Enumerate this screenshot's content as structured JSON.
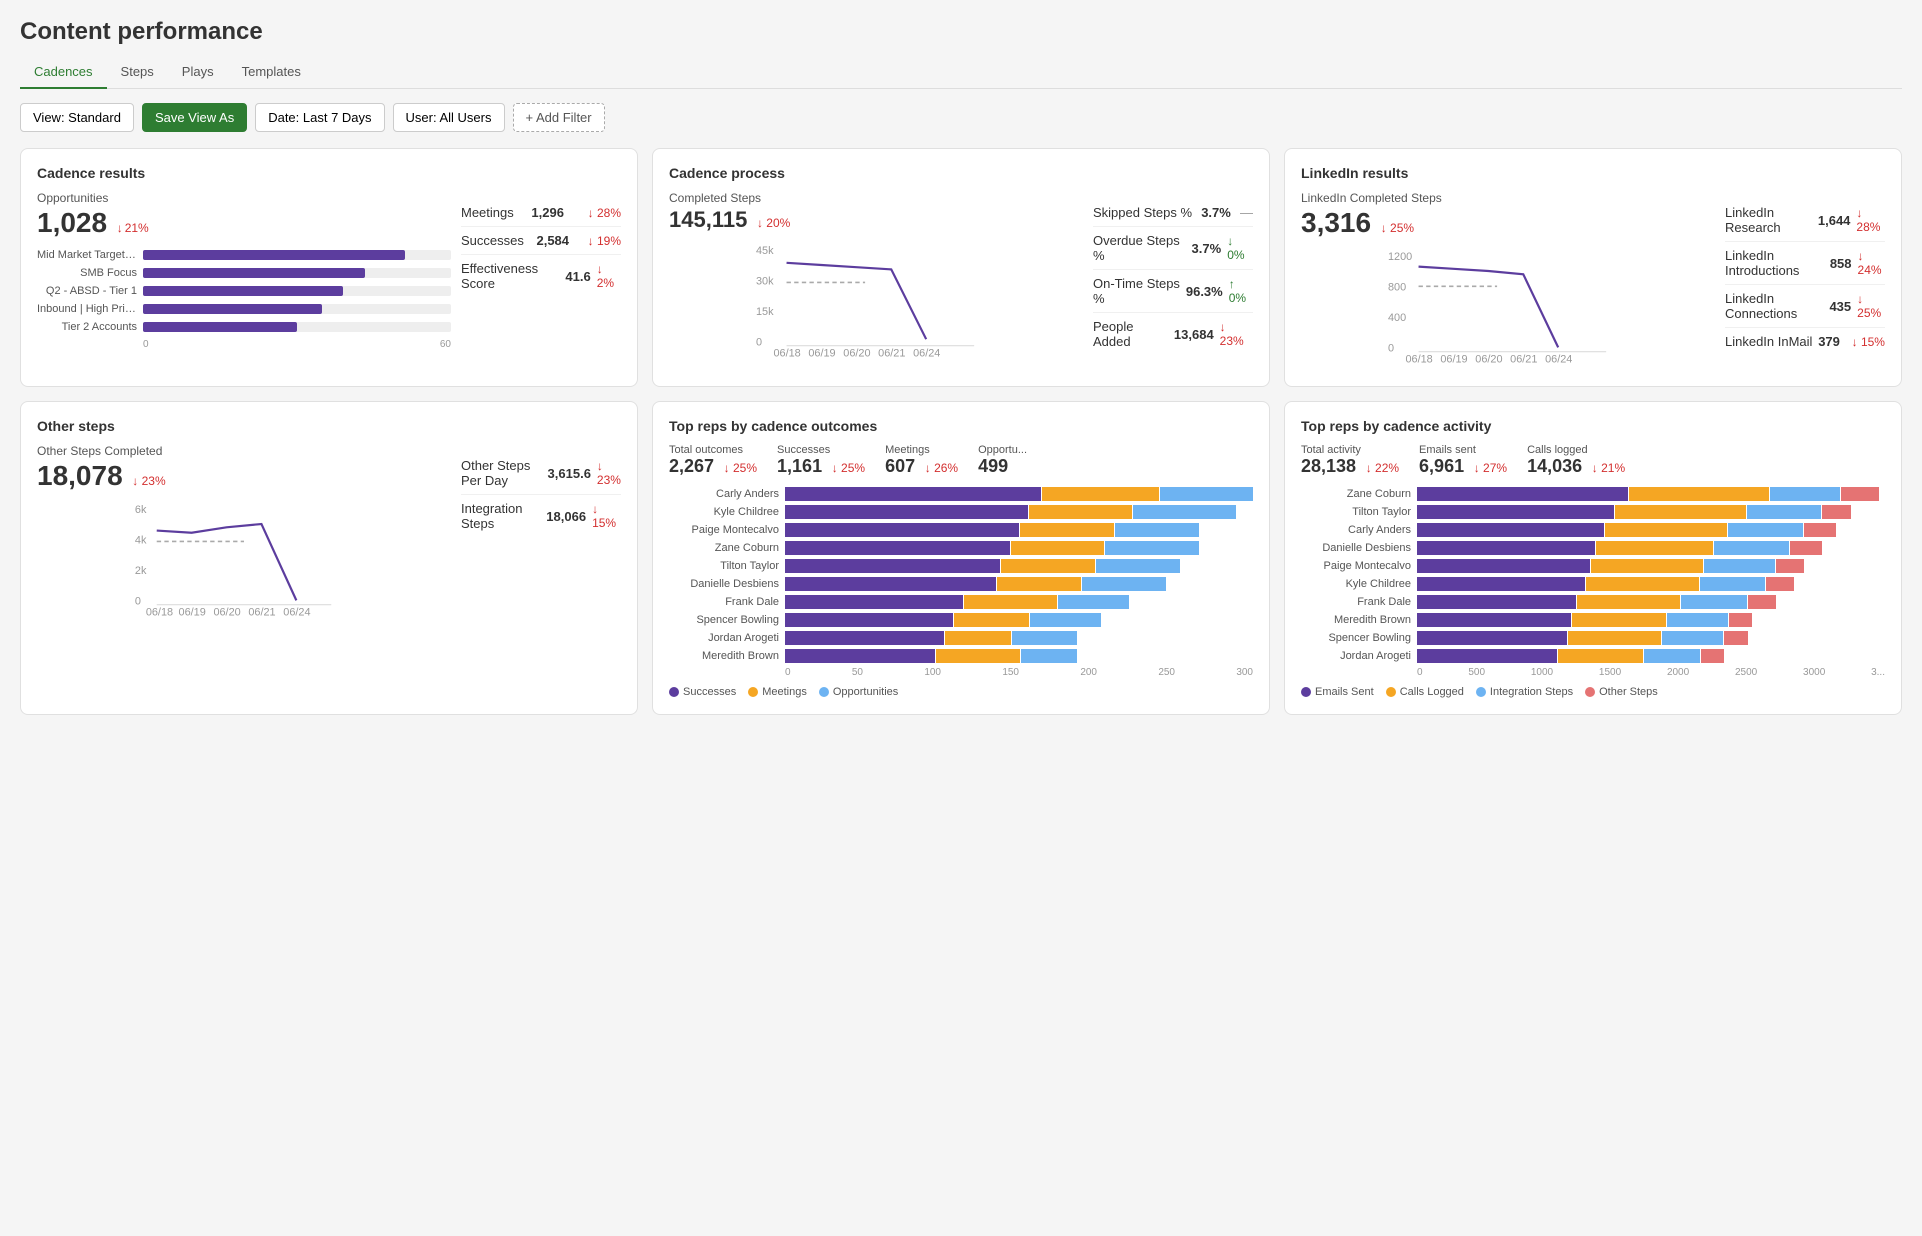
{
  "page": {
    "title": "Content performance"
  },
  "tabs": [
    {
      "label": "Cadences",
      "active": true
    },
    {
      "label": "Steps",
      "active": false
    },
    {
      "label": "Plays",
      "active": false
    },
    {
      "label": "Templates",
      "active": false
    }
  ],
  "toolbar": {
    "view_label": "View: Standard",
    "save_view_label": "Save View As",
    "date_label": "Date: Last 7 Days",
    "user_label": "User: All Users",
    "add_filter_label": "+ Add Filter"
  },
  "cadence_results": {
    "title": "Cadence results",
    "opportunities_label": "Opportunities",
    "opportunities_value": "1,028",
    "opportunities_change": "↓ 21%",
    "meetings_label": "Meetings",
    "meetings_value": "1,296",
    "meetings_change": "↓ 28%",
    "successes_label": "Successes",
    "successes_value": "2,584",
    "successes_change": "↓ 19%",
    "effectiveness_label": "Effectiveness Score",
    "effectiveness_value": "41.6",
    "effectiveness_change": "↓ 2%",
    "bars": [
      {
        "label": "Mid Market Target Acco...",
        "pct": 85
      },
      {
        "label": "SMB Focus",
        "pct": 72
      },
      {
        "label": "Q2 - ABSD - Tier 1",
        "pct": 65
      },
      {
        "label": "Inbound | High Priority (...",
        "pct": 58
      },
      {
        "label": "Tier 2 Accounts",
        "pct": 50
      }
    ],
    "axis_min": "0",
    "axis_max": "60"
  },
  "cadence_process": {
    "title": "Cadence process",
    "completed_label": "Completed Steps",
    "completed_value": "145,115",
    "completed_change": "↓ 20%",
    "skipped_label": "Skipped Steps %",
    "skipped_value": "3.7%",
    "overdue_label": "Overdue Steps %",
    "overdue_value": "3.7%",
    "overdue_change": "↓ 0%",
    "ontime_label": "On-Time Steps %",
    "ontime_value": "96.3%",
    "ontime_change": "↑ 0%",
    "people_label": "People Added",
    "people_value": "13,684",
    "people_change": "↓ 23%",
    "chart": {
      "y_labels": [
        "45k",
        "30k",
        "15k",
        "0"
      ],
      "x_labels": [
        "06/18",
        "06/19",
        "06/20",
        "06/21",
        "06/24"
      ]
    }
  },
  "linkedin_results": {
    "title": "LinkedIn results",
    "completed_label": "LinkedIn Completed Steps",
    "completed_value": "3,316",
    "completed_change": "↓ 25%",
    "items": [
      {
        "label": "LinkedIn Research",
        "value": "1,644",
        "change": "↓ 28%"
      },
      {
        "label": "LinkedIn Introductions",
        "value": "858",
        "change": "↓ 24%"
      },
      {
        "label": "LinkedIn Connections",
        "value": "435",
        "change": "↓ 25%"
      },
      {
        "label": "LinkedIn InMail",
        "value": "379",
        "change": "↓ 15%"
      }
    ],
    "chart": {
      "y_labels": [
        "1200",
        "800",
        "400",
        "0"
      ],
      "x_labels": [
        "06/18",
        "06/19",
        "06/20",
        "06/21",
        "06/24"
      ]
    }
  },
  "other_steps": {
    "title": "Other steps",
    "completed_label": "Other Steps Completed",
    "completed_value": "18,078",
    "completed_change": "↓ 23%",
    "per_day_label": "Other Steps Per Day",
    "per_day_value": "3,615.6",
    "per_day_change": "↓ 23%",
    "integration_label": "Integration Steps",
    "integration_value": "18,066",
    "integration_change": "↓ 15%",
    "chart": {
      "y_labels": [
        "6k",
        "4k",
        "2k",
        "0"
      ],
      "x_labels": [
        "06/18",
        "06/19",
        "06/20",
        "06/21",
        "06/24"
      ]
    }
  },
  "top_outcomes": {
    "title": "Top reps by cadence outcomes",
    "metrics": [
      {
        "label": "Total outcomes",
        "value": "2,267",
        "change": "↓ 25%"
      },
      {
        "label": "Successes",
        "value": "1,161",
        "change": "↓ 25%"
      },
      {
        "label": "Meetings",
        "value": "607",
        "change": "↓ 26%"
      },
      {
        "label": "Opportu...",
        "value": "499",
        "change": ""
      }
    ],
    "reps": [
      {
        "name": "Carly Anders",
        "purple": 55,
        "orange": 25,
        "blue": 20
      },
      {
        "name": "Kyle Childree",
        "purple": 52,
        "orange": 22,
        "blue": 22
      },
      {
        "name": "Paige Montecalvo",
        "purple": 50,
        "orange": 20,
        "blue": 18
      },
      {
        "name": "Zane Coburn",
        "purple": 48,
        "orange": 20,
        "blue": 20
      },
      {
        "name": "Tilton Taylor",
        "purple": 46,
        "orange": 20,
        "blue": 18
      },
      {
        "name": "Danielle Desbiens",
        "purple": 45,
        "orange": 18,
        "blue": 18
      },
      {
        "name": "Frank Dale",
        "purple": 38,
        "orange": 20,
        "blue": 15
      },
      {
        "name": "Spencer Bowling",
        "purple": 36,
        "orange": 16,
        "blue": 15
      },
      {
        "name": "Jordan Arogeti",
        "purple": 34,
        "orange": 14,
        "blue": 14
      },
      {
        "name": "Meredith Brown",
        "purple": 32,
        "orange": 18,
        "blue": 12
      }
    ],
    "axis": [
      "0",
      "50",
      "100",
      "150",
      "200",
      "250",
      "300"
    ],
    "legend": [
      {
        "label": "Successes",
        "color": "#5c3d9e"
      },
      {
        "label": "Meetings",
        "color": "#f5a623"
      },
      {
        "label": "Opportunities",
        "color": "#6db3f2"
      }
    ]
  },
  "top_activity": {
    "title": "Top reps by cadence activity",
    "metrics": [
      {
        "label": "Total activity",
        "value": "28,138",
        "change": "↓ 22%"
      },
      {
        "label": "Emails sent",
        "value": "6,961",
        "change": "↓ 27%"
      },
      {
        "label": "Calls logged",
        "value": "14,036",
        "change": "↓ 21%"
      }
    ],
    "reps": [
      {
        "name": "Zane Coburn",
        "purple": 45,
        "orange": 30,
        "blue": 15,
        "red": 8
      },
      {
        "name": "Tilton Taylor",
        "purple": 42,
        "orange": 28,
        "blue": 16,
        "red": 6
      },
      {
        "name": "Carly Anders",
        "purple": 40,
        "orange": 26,
        "blue": 16,
        "red": 7
      },
      {
        "name": "Danielle Desbiens",
        "purple": 38,
        "orange": 25,
        "blue": 16,
        "red": 7
      },
      {
        "name": "Paige Montecalvo",
        "purple": 37,
        "orange": 24,
        "blue": 15,
        "red": 6
      },
      {
        "name": "Kyle Childree",
        "purple": 36,
        "orange": 24,
        "blue": 14,
        "red": 6
      },
      {
        "name": "Frank Dale",
        "purple": 34,
        "orange": 22,
        "blue": 14,
        "red": 6
      },
      {
        "name": "Meredith Brown",
        "purple": 33,
        "orange": 20,
        "blue": 13,
        "red": 5
      },
      {
        "name": "Spencer Bowling",
        "purple": 32,
        "orange": 20,
        "blue": 13,
        "red": 5
      },
      {
        "name": "Jordan Arogeti",
        "purple": 30,
        "orange": 18,
        "blue": 12,
        "red": 5
      }
    ],
    "axis": [
      "0",
      "500",
      "1000",
      "1500",
      "2000",
      "2500",
      "3000",
      "3..."
    ],
    "legend": [
      {
        "label": "Emails Sent",
        "color": "#5c3d9e"
      },
      {
        "label": "Calls Logged",
        "color": "#f5a623"
      },
      {
        "label": "Integration Steps",
        "color": "#6db3f2"
      },
      {
        "label": "Other Steps",
        "color": "#e57373"
      }
    ]
  }
}
